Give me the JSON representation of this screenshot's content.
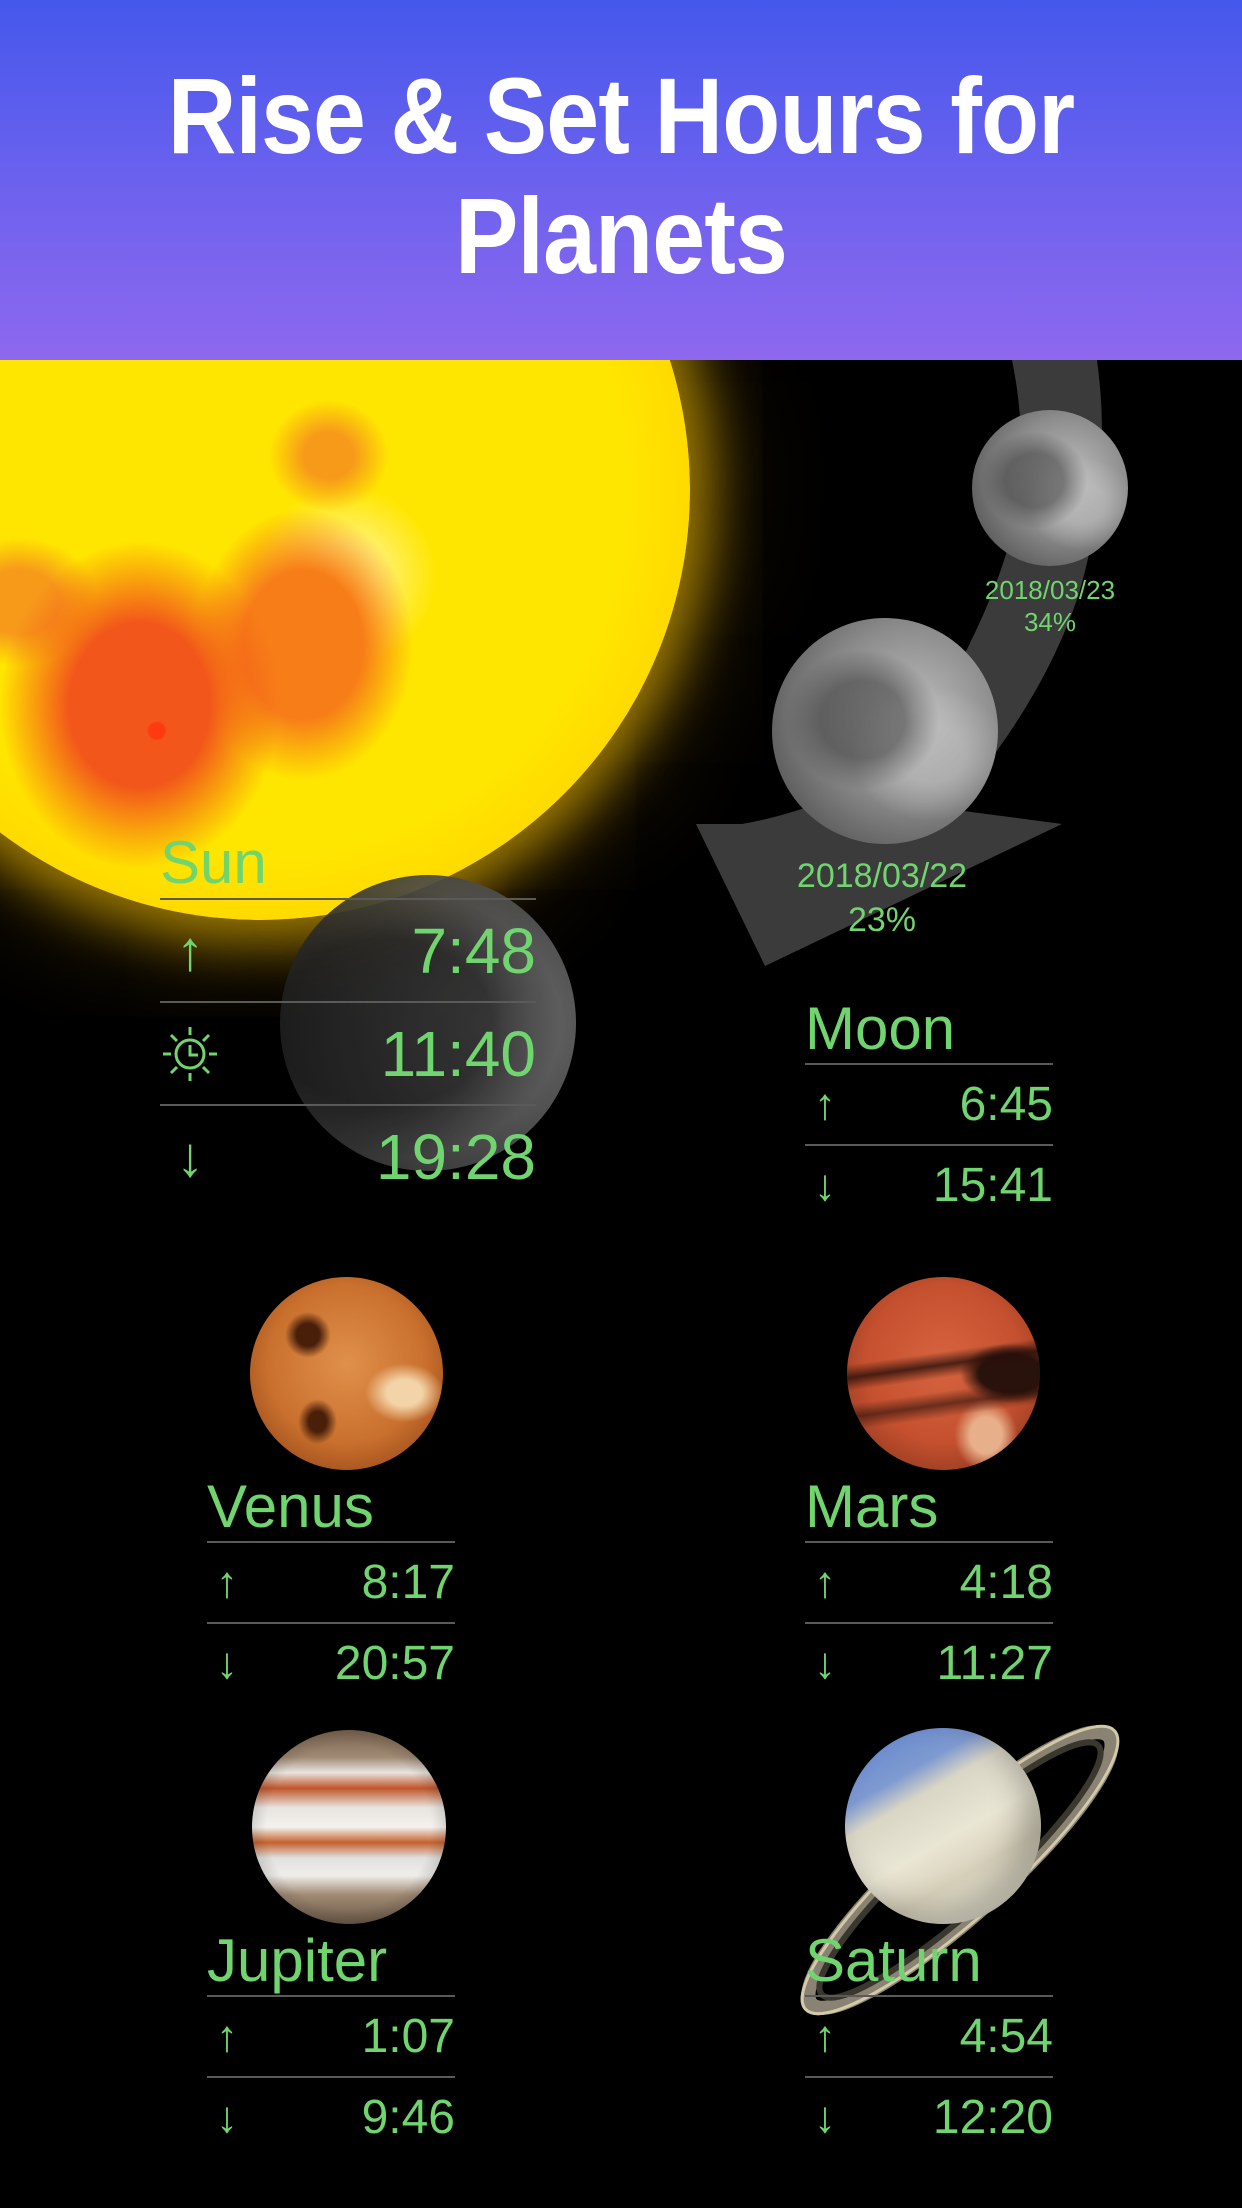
{
  "header": {
    "title_line1": "Rise & Set Hours for",
    "title_line2": "Planets",
    "gradient_top": "#4558ec",
    "gradient_bottom": "#8e68ef"
  },
  "accent_color": "#70d46f",
  "moon_phases": [
    {
      "date": "2018/03/23",
      "illumination": "34%"
    },
    {
      "date": "2018/03/22",
      "illumination": "23%"
    }
  ],
  "bodies": {
    "sun": {
      "name": "Sun",
      "rows": [
        {
          "icon": "rise-arrow-icon",
          "glyph": "↑",
          "time": "7:48"
        },
        {
          "icon": "sun-clock-icon",
          "glyph": "",
          "time": "11:40"
        },
        {
          "icon": "set-arrow-icon",
          "glyph": "↓",
          "time": "19:28"
        }
      ]
    },
    "moon": {
      "name": "Moon",
      "rows": [
        {
          "icon": "rise-arrow-icon",
          "glyph": "↑",
          "time": "6:45"
        },
        {
          "icon": "set-arrow-icon",
          "glyph": "↓",
          "time": "15:41"
        }
      ]
    },
    "venus": {
      "name": "Venus",
      "rows": [
        {
          "icon": "rise-arrow-icon",
          "glyph": "↑",
          "time": "8:17"
        },
        {
          "icon": "set-arrow-icon",
          "glyph": "↓",
          "time": "20:57"
        }
      ]
    },
    "mars": {
      "name": "Mars",
      "rows": [
        {
          "icon": "rise-arrow-icon",
          "glyph": "↑",
          "time": "4:18"
        },
        {
          "icon": "set-arrow-icon",
          "glyph": "↓",
          "time": "11:27"
        }
      ]
    },
    "jupiter": {
      "name": "Jupiter",
      "rows": [
        {
          "icon": "rise-arrow-icon",
          "glyph": "↑",
          "time": "1:07"
        },
        {
          "icon": "set-arrow-icon",
          "glyph": "↓",
          "time": "9:46"
        }
      ]
    },
    "saturn": {
      "name": "Saturn",
      "rows": [
        {
          "icon": "rise-arrow-icon",
          "glyph": "↑",
          "time": "4:54"
        },
        {
          "icon": "set-arrow-icon",
          "glyph": "↓",
          "time": "12:20"
        }
      ]
    }
  }
}
